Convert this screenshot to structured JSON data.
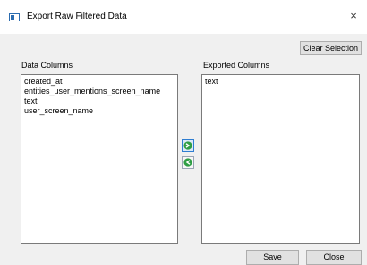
{
  "window": {
    "title": "Export Raw Filtered Data",
    "close_symbol": "×"
  },
  "toolbar": {
    "clear_selection_label": "Clear Selection"
  },
  "data_columns": {
    "label": "Data Columns",
    "items": [
      "created_at",
      "entities_user_mentions_screen_name",
      "text",
      "user_screen_name"
    ]
  },
  "exported_columns": {
    "label": "Exported Columns",
    "items": [
      "text"
    ]
  },
  "buttons": {
    "save_label": "Save",
    "close_label": "Close"
  },
  "icons": {
    "add": "arrow-right-icon",
    "remove": "arrow-left-icon",
    "accent_color": "#2f9e44"
  }
}
